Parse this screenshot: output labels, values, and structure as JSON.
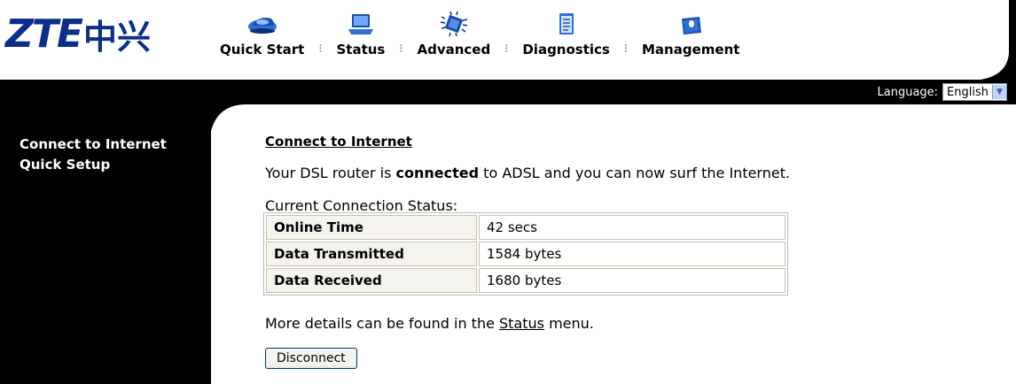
{
  "brand": {
    "logo_latin": "ZTE",
    "logo_chinese": "中兴"
  },
  "nav": [
    {
      "label": "Quick Start",
      "icon": "car-icon"
    },
    {
      "label": "Status",
      "icon": "laptop-icon"
    },
    {
      "label": "Advanced",
      "icon": "chip-icon"
    },
    {
      "label": "Diagnostics",
      "icon": "clipboard-icon"
    },
    {
      "label": "Management",
      "icon": "briefcase-icon"
    }
  ],
  "nav_separator": "⁝",
  "language": {
    "label": "Language:",
    "selected": "English"
  },
  "sidebar": {
    "items": [
      "Connect to Internet",
      "Quick Setup"
    ]
  },
  "main": {
    "title": "Connect to Internet",
    "message_pre": "Your DSL router is ",
    "message_bold": "connected",
    "message_post": " to ADSL and you can now surf the Internet.",
    "status_caption": "Current Connection Status:",
    "rows": [
      {
        "label": "Online Time",
        "value": "42 secs"
      },
      {
        "label": "Data Transmitted",
        "value": "1584 bytes"
      },
      {
        "label": "Data Received",
        "value": "1680 bytes"
      }
    ],
    "details_pre": "More details can be found in the ",
    "details_link": "Status",
    "details_post": " menu.",
    "button_label": "Disconnect"
  },
  "colors": {
    "brand_blue": "#0a2f8a",
    "bar_black": "#000000"
  }
}
